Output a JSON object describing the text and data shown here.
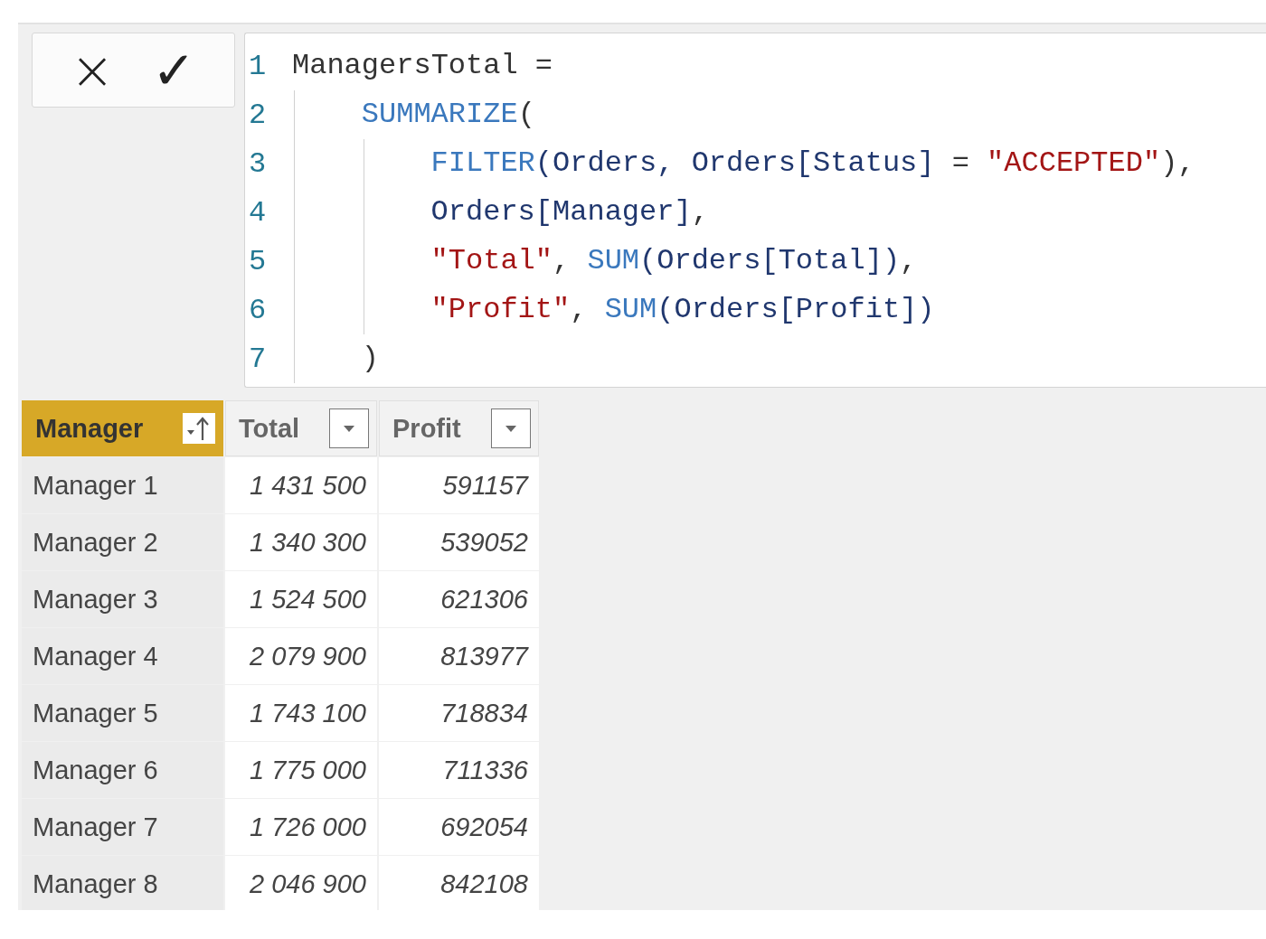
{
  "formula_bar": {
    "cancel": "×",
    "commit": "✓",
    "lines": [
      {
        "number": "1",
        "tokens": [
          {
            "text": "ManagersTotal =",
            "kind": "plain"
          }
        ],
        "children": [
          {
            "number": "2",
            "tokens": [
              {
                "text": "SUMMARIZE",
                "kind": "func"
              },
              {
                "text": "(",
                "kind": "plain"
              }
            ],
            "children": [
              {
                "number": "3",
                "tokens": [
                  {
                    "text": "FILTER",
                    "kind": "func"
                  },
                  {
                    "text": "(Orders, Orders[Status]",
                    "kind": "ident"
                  },
                  {
                    "text": " = ",
                    "kind": "plain"
                  },
                  {
                    "text": "\"ACCEPTED\"",
                    "kind": "string"
                  },
                  {
                    "text": "),",
                    "kind": "plain"
                  }
                ]
              },
              {
                "number": "4",
                "tokens": [
                  {
                    "text": "Orders[Manager]",
                    "kind": "ident"
                  },
                  {
                    "text": ",",
                    "kind": "plain"
                  }
                ]
              },
              {
                "number": "5",
                "tokens": [
                  {
                    "text": "\"Total\"",
                    "kind": "string"
                  },
                  {
                    "text": ", ",
                    "kind": "plain"
                  },
                  {
                    "text": "SUM",
                    "kind": "func"
                  },
                  {
                    "text": "(Orders[Total])",
                    "kind": "ident"
                  },
                  {
                    "text": ",",
                    "kind": "plain"
                  }
                ]
              },
              {
                "number": "6",
                "tokens": [
                  {
                    "text": "\"Profit\"",
                    "kind": "string"
                  },
                  {
                    "text": ", ",
                    "kind": "plain"
                  },
                  {
                    "text": "SUM",
                    "kind": "func"
                  },
                  {
                    "text": "(Orders[Profit])",
                    "kind": "ident"
                  }
                ]
              }
            ]
          },
          {
            "number": "7",
            "tokens": [
              {
                "text": ")",
                "kind": "plain"
              }
            ]
          }
        ]
      }
    ]
  },
  "table": {
    "columns": [
      {
        "label": "Manager",
        "kind": "text",
        "selected": true,
        "sorted": true
      },
      {
        "label": "Total",
        "kind": "number",
        "selected": false,
        "sorted": false
      },
      {
        "label": "Profit",
        "kind": "number",
        "selected": false,
        "sorted": false
      }
    ],
    "rows": [
      [
        "Manager 1",
        "1 431 500",
        "591157"
      ],
      [
        "Manager 2",
        "1 340 300",
        "539052"
      ],
      [
        "Manager 3",
        "1 524 500",
        "621306"
      ],
      [
        "Manager 4",
        "2 079 900",
        "813977"
      ],
      [
        "Manager 5",
        "1 743 100",
        "718834"
      ],
      [
        "Manager 6",
        "1 775 000",
        "711336"
      ],
      [
        "Manager 7",
        "1 726 000",
        "692054"
      ],
      [
        "Manager 8",
        "2 046 900",
        "842108"
      ]
    ]
  }
}
